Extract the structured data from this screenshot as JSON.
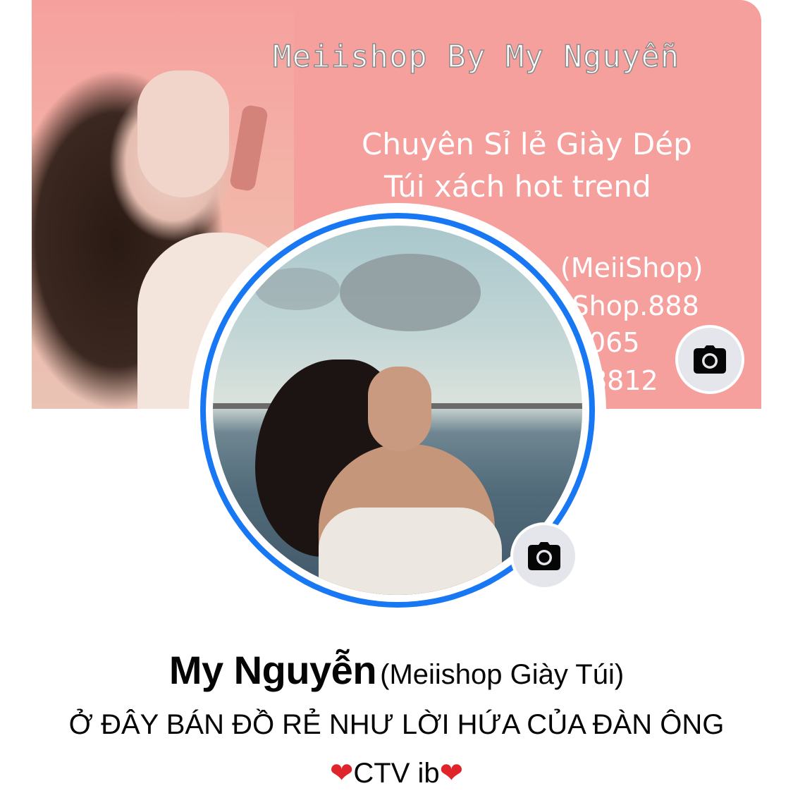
{
  "cover": {
    "title": "Meiishop By My Nguyễn",
    "line1": "Chuyên Sỉ lẻ Giày Dép",
    "line2": "Túi xách hot trend",
    "contact1": "(MeiiShop)",
    "contact2": "iShop.888",
    "contact3": "065",
    "contact4": "8812",
    "background_color": "#f6a09e",
    "camera_icon": "camera-icon"
  },
  "profile": {
    "ring_color": "#1877f2",
    "camera_icon": "camera-icon",
    "name": "My Nguyễn",
    "alternate_name": "(Meiishop Giày Túi)",
    "bio_line1": "Ở ĐÂY BÁN ĐỒ RẺ NHƯ LỜI HỨA CỦA ĐÀN ÔNG",
    "bio_heart": "❤",
    "bio_line2_text": "CTV ib"
  }
}
